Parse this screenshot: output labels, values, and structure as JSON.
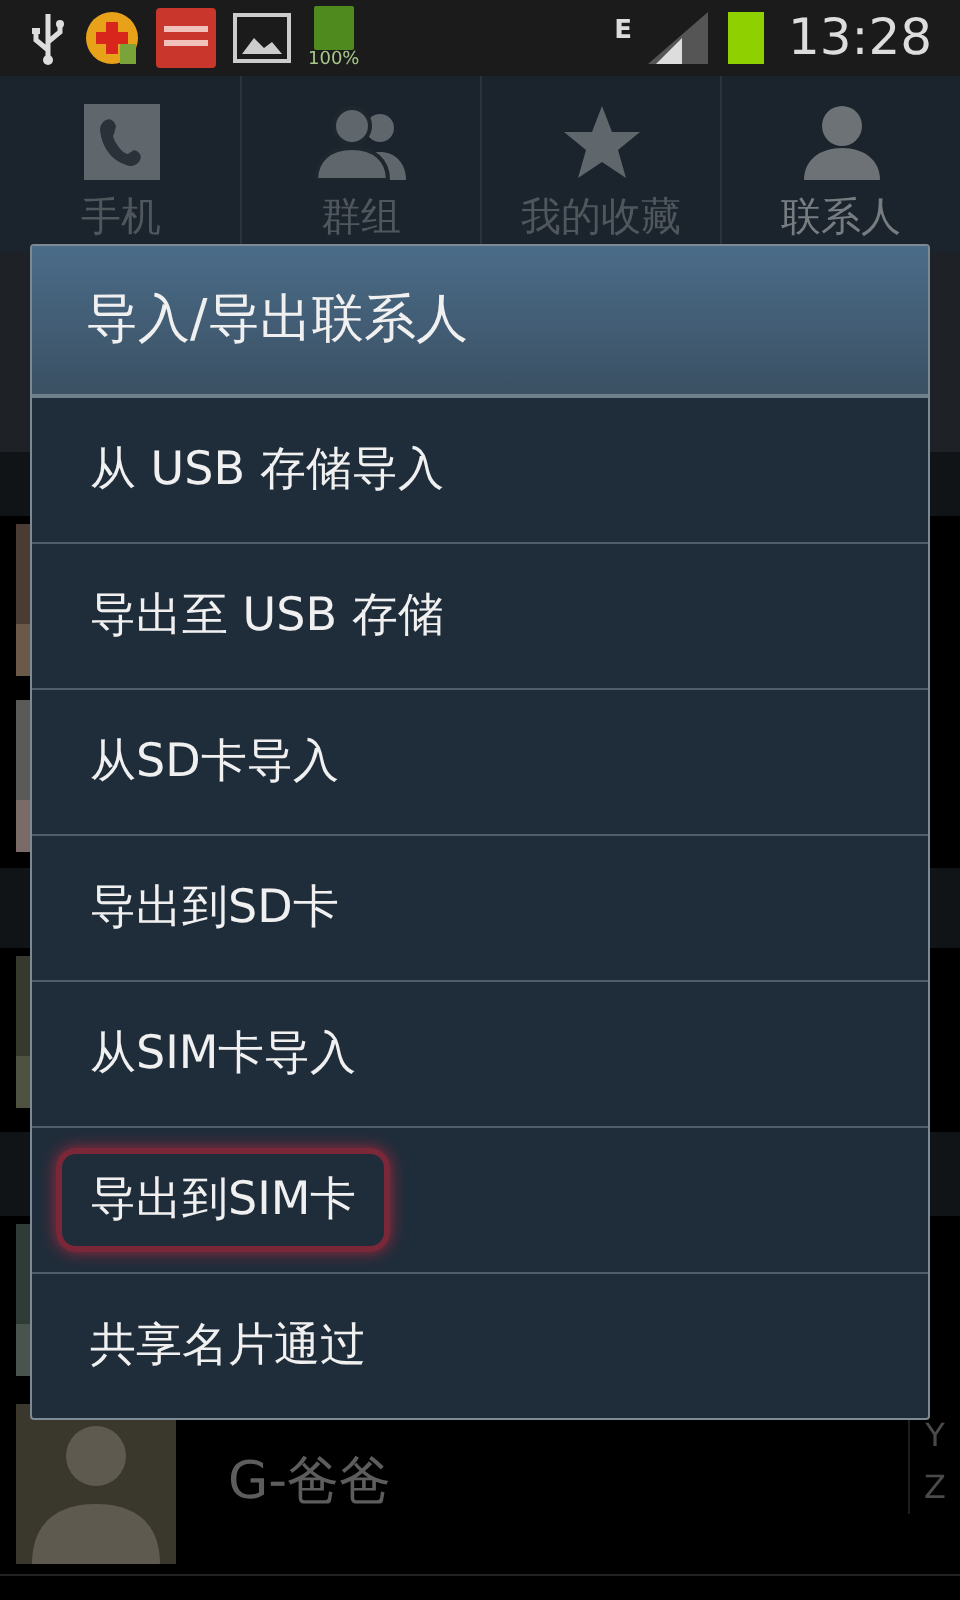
{
  "status_bar": {
    "battery_label": "100%",
    "network": "E",
    "time": "13:28"
  },
  "tabs": [
    {
      "label": "手机",
      "kind": "phone",
      "selected": false
    },
    {
      "label": "群组",
      "kind": "group",
      "selected": false
    },
    {
      "label": "我的收藏",
      "kind": "star",
      "selected": false
    },
    {
      "label": "联系人",
      "kind": "person",
      "selected": true
    }
  ],
  "dialog": {
    "title": "导入/导出联系人",
    "items": [
      {
        "label": "从 USB 存储导入",
        "highlighted": false
      },
      {
        "label": "导出至 USB 存储",
        "highlighted": false
      },
      {
        "label": "从SD卡导入",
        "highlighted": false
      },
      {
        "label": "导出到SD卡",
        "highlighted": false
      },
      {
        "label": "从SIM卡导入",
        "highlighted": false
      },
      {
        "label": "导出到SIM卡",
        "highlighted": true
      },
      {
        "label": "共享名片通过",
        "highlighted": false
      }
    ]
  },
  "contacts": [
    {
      "name": "G-爸爸"
    }
  ],
  "index_letters": [
    "Y",
    "Z"
  ]
}
